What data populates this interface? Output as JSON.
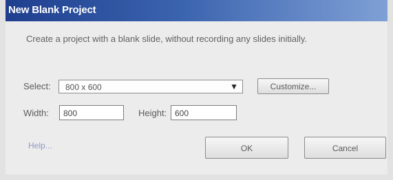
{
  "window": {
    "title": "New Blank Project"
  },
  "description": "Create a project with a blank slide, without recording any slides initially.",
  "select": {
    "label": "Select:",
    "value": "800 x 600"
  },
  "customize_label": "Customize...",
  "width": {
    "label": "Width:",
    "value": "800"
  },
  "height": {
    "label": "Height:",
    "value": "600"
  },
  "help_label": "Help...",
  "ok_label": "OK",
  "cancel_label": "Cancel"
}
